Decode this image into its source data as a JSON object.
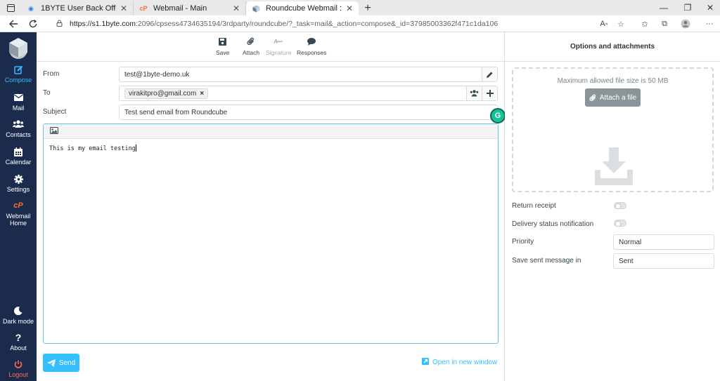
{
  "browser": {
    "tabs": [
      {
        "title": "1BYTE User Back Office",
        "favicon": "1byte-icon"
      },
      {
        "title": "Webmail - Main",
        "favicon": "cpanel-icon"
      },
      {
        "title": "Roundcube Webmail :: Compose",
        "favicon": "roundcube-icon",
        "active": true
      }
    ],
    "url_host": "https://s1.1byte.com",
    "url_rest": ":2096/cpsess4734635194/3rdparty/roundcube/?_task=mail&_action=compose&_id=37985003362f471c1da106"
  },
  "sidebar": {
    "items": [
      {
        "label": "Compose",
        "icon": "compose-icon"
      },
      {
        "label": "Mail",
        "icon": "envelope-icon"
      },
      {
        "label": "Contacts",
        "icon": "users-icon"
      },
      {
        "label": "Calendar",
        "icon": "calendar-icon"
      },
      {
        "label": "Settings",
        "icon": "gear-icon"
      },
      {
        "label": "Webmail Home",
        "icon": "cpanel-icon"
      }
    ],
    "bottom": [
      {
        "label": "Dark mode",
        "icon": "moon-icon"
      },
      {
        "label": "About",
        "icon": "question-icon"
      },
      {
        "label": "Logout",
        "icon": "power-icon"
      }
    ]
  },
  "toolbar": {
    "save": "Save",
    "attach": "Attach",
    "signature": "Signature",
    "responses": "Responses"
  },
  "compose": {
    "from_label": "From",
    "from_value": "test@1byte-demo.uk",
    "to_label": "To",
    "to_recipient": "virakitpro@gmail.com",
    "subject_label": "Subject",
    "subject_value": "Test send email from Roundcube",
    "body": "This is my email testing",
    "send_label": "Send",
    "open_window_label": "Open in new window"
  },
  "options": {
    "title": "Options and attachments",
    "max_size_text": "Maximum allowed file size is 50 MB",
    "attach_button": "Attach a file",
    "return_receipt": "Return receipt",
    "delivery_status": "Delivery status notification",
    "priority_label": "Priority",
    "priority_value": "Normal",
    "save_sent_label": "Save sent message in",
    "save_sent_value": "Sent"
  },
  "colors": {
    "accent": "#37beff",
    "sidebar": "#1b2b4b",
    "logout": "#ff6a5c"
  }
}
